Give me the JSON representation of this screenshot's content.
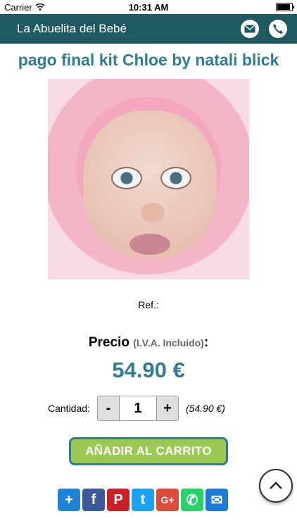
{
  "status_bar": {
    "carrier": "Carrier",
    "time": "10:31 AM",
    "battery_level": 1.0
  },
  "header": {
    "title": "La Abuelita del Bebé",
    "icons": [
      "mail-icon",
      "phone-icon"
    ]
  },
  "product": {
    "title": "pago final kit Chloe by natali blick",
    "ref_label": "Ref.:",
    "price_label": "Precio",
    "price_note": "(I.V.A. Incluido)",
    "price_colon": ":",
    "price": "54.90 €"
  },
  "quantity": {
    "label": "Cantidad:",
    "minus": "-",
    "value": "1",
    "plus": "+",
    "total": "(54.90 €)"
  },
  "actions": {
    "add_to_cart": "AÑADIR AL CARRITO"
  },
  "share": [
    {
      "name": "share-plus-icon",
      "glyph": "+",
      "color": "#1f84d6"
    },
    {
      "name": "facebook-icon",
      "glyph": "f",
      "color": "#3b5998"
    },
    {
      "name": "pinterest-icon",
      "glyph": "P",
      "color": "#cb2027"
    },
    {
      "name": "twitter-icon",
      "glyph": "t",
      "color": "#1da1f2"
    },
    {
      "name": "google-plus-icon",
      "glyph": "G+",
      "color": "#dd4b39"
    },
    {
      "name": "whatsapp-icon",
      "glyph": "✆",
      "color": "#25d366"
    },
    {
      "name": "email-share-icon",
      "glyph": "✉",
      "color": "#1c7cd5"
    }
  ],
  "colors": {
    "header_bg": "#1f5a63",
    "accent": "#2f7d92",
    "button_bg": "#9cc952"
  }
}
